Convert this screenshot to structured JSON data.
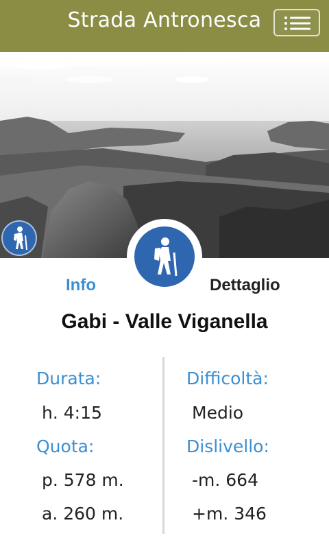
{
  "header": {
    "title": "Strada Antronesca",
    "background_color": "#8a8d43",
    "menu_icon": "hamburger-menu-icon"
  },
  "hero": {
    "image_style": "grayscale",
    "badge_icon": "hiker-icon"
  },
  "tabs": {
    "info_label": "Info",
    "detail_label": "Dettaglio",
    "center_icon": "hiker-icon"
  },
  "route": {
    "title": "Gabi - Valle Viganella"
  },
  "details": {
    "durata_label": "Durata:",
    "durata_value": "h. 4:15",
    "difficolta_label": "Difficoltà:",
    "difficolta_value": "Medio",
    "quota_label": "Quota:",
    "quota_peak": "p. 578 m.",
    "quota_arrival": "a. 260 m.",
    "dislivello_label": "Dislivello:",
    "dislivello_down": "-m. 664",
    "dislivello_up": "+m. 346"
  },
  "colors": {
    "accent_blue": "#3b8fd1",
    "badge_blue": "#2f66b0"
  }
}
